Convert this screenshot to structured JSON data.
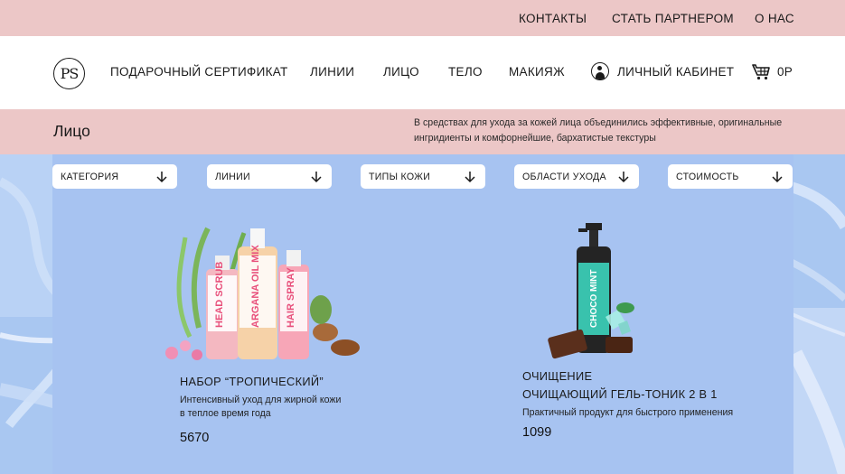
{
  "topbar": {
    "contacts": "КОНТАКТЫ",
    "partner": "СТАТЬ ПАРТНЕРОМ",
    "about": "О НАС"
  },
  "nav": {
    "logo": "PS",
    "gift": "ПОДАРОЧНЫЙ СЕРТИФИКАТ",
    "lines": "ЛИНИИ",
    "face": "ЛИЦО",
    "body": "ТЕЛО",
    "makeup": "МАКИЯЖ",
    "account": "ЛИЧНЫЙ КАБИНЕТ",
    "cart_total": "0Р"
  },
  "page": {
    "title": "Лицо",
    "description": "В средствах для ухода за кожей лица объединились эффективные, оригинальные ингридиенты и комфорнейшие, бархатистые текстуры"
  },
  "filters": [
    {
      "label": "КАТЕГОРИЯ"
    },
    {
      "label": "ЛИНИИ"
    },
    {
      "label": "ТИПЫ КОЖИ"
    },
    {
      "label": "ОБЛАСТИ УХОДА"
    },
    {
      "label": "СТОИМОСТЬ"
    }
  ],
  "products": [
    {
      "title_line1": "НАБОР “ТРОПИЧЕСКИЙ”",
      "desc_line1": "Интенсивный уход для жирной кожи",
      "desc_line2": "в теплое время года",
      "price": "5670",
      "bottle_labels": [
        "HEAD SCRUB",
        "ARGANA OIL MIX",
        "HAIR SPRAY"
      ]
    },
    {
      "title_line1": "ОЧИЩЕНИЕ",
      "title_line2": "ОЧИЩАЮЩИЙ ГЕЛЬ-ТОНИК 2 В 1",
      "desc_line1": "Практичный продукт для быстрого применения",
      "price": "1099",
      "bottle_labels": [
        "CHOCO MINT"
      ]
    }
  ],
  "colors": {
    "pink_band": "#ecc7c7",
    "blue_bg": "#a9c7f1",
    "white": "#ffffff",
    "text": "#1a1a1a"
  },
  "icons": [
    "user-icon",
    "cart-icon",
    "arrow-down-icon"
  ]
}
